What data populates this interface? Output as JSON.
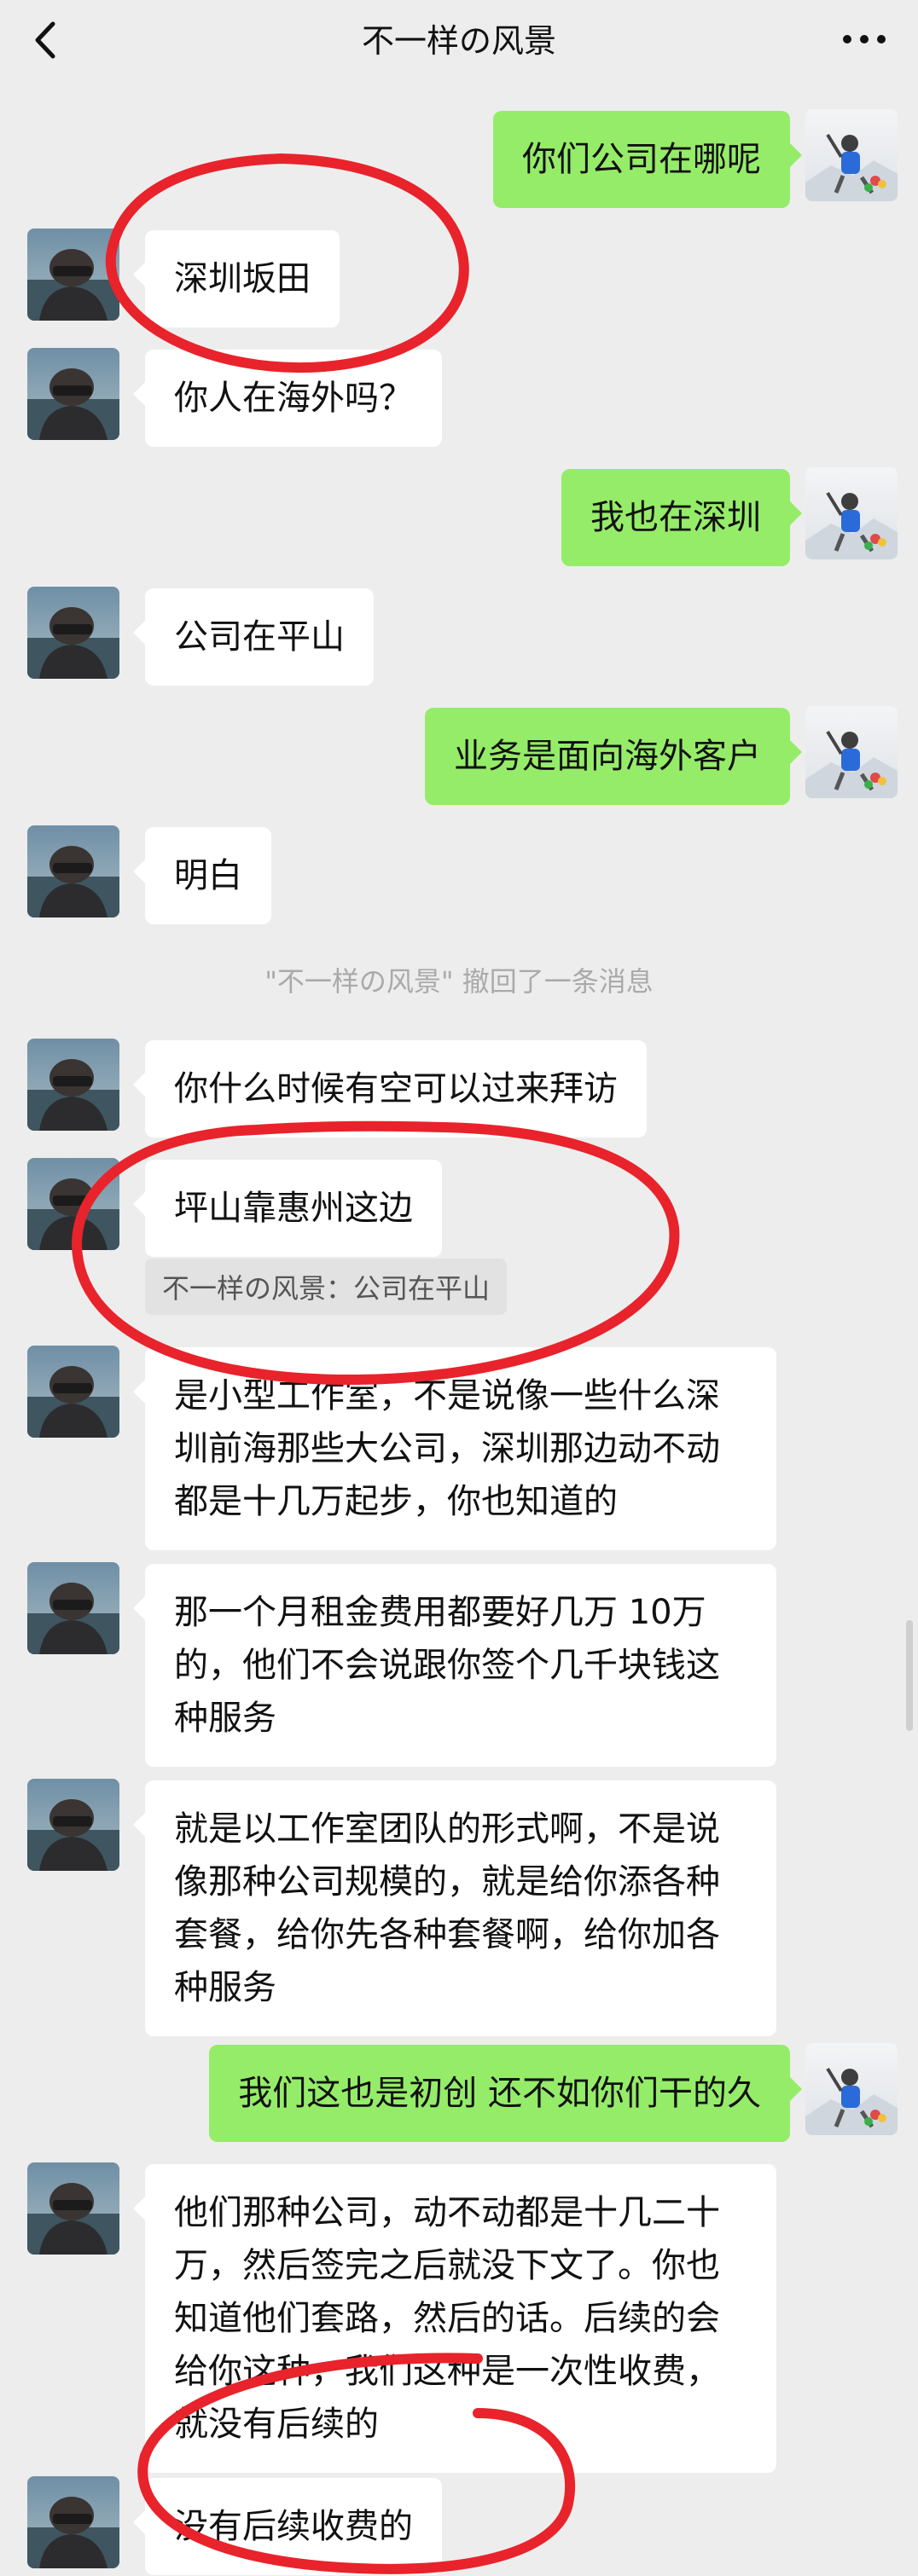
{
  "header": {
    "title": "不一样の风景",
    "back_icon": "chevron-left-icon",
    "more_icon": "more-dots-icon"
  },
  "messages": [
    {
      "side": "out",
      "text": "你们公司在哪呢"
    },
    {
      "side": "in",
      "text": "深圳坂田"
    },
    {
      "side": "in",
      "text": "你人在海外吗？"
    },
    {
      "side": "out",
      "text": "我也在深圳"
    },
    {
      "side": "in",
      "text": "公司在平山"
    },
    {
      "side": "out",
      "text": "业务是面向海外客户"
    },
    {
      "side": "in",
      "text": "明白"
    },
    {
      "side": "system",
      "text": "\"不一样の风景\" 撤回了一条消息"
    },
    {
      "side": "in",
      "text": "你什么时候有空可以过来拜访"
    },
    {
      "side": "in",
      "text": "坪山靠惠州这边",
      "quote": "不一样の风景：公司在平山"
    },
    {
      "side": "in",
      "text": "是小型工作室，不是说像一些什么深圳前海那些大公司，深圳那边动不动都是十几万起步，你也知道的"
    },
    {
      "side": "in",
      "text": "那一个月租金费用都要好几万 10万的，他们不会说跟你签个几千块钱这种服务"
    },
    {
      "side": "in",
      "text": "就是以工作室团队的形式啊，不是说像那种公司规模的，就是给你添各种套餐，给你先各种套餐啊，给你加各种服务"
    },
    {
      "side": "out",
      "text": "我们这也是初创 还不如你们干的久"
    },
    {
      "side": "in",
      "text": "他们那种公司，动不动都是十几二十万，然后签完之后就没下文了。你也知道他们套路，然后的话。后续的会给你这种，我们这种是一次性收费，就没有后续的"
    },
    {
      "side": "in",
      "text": "没有后续收费的"
    }
  ],
  "colors": {
    "background": "#ededed",
    "outgoing_bubble": "#95ec69",
    "incoming_bubble": "#ffffff",
    "annotation_circle": "#e8232b"
  }
}
